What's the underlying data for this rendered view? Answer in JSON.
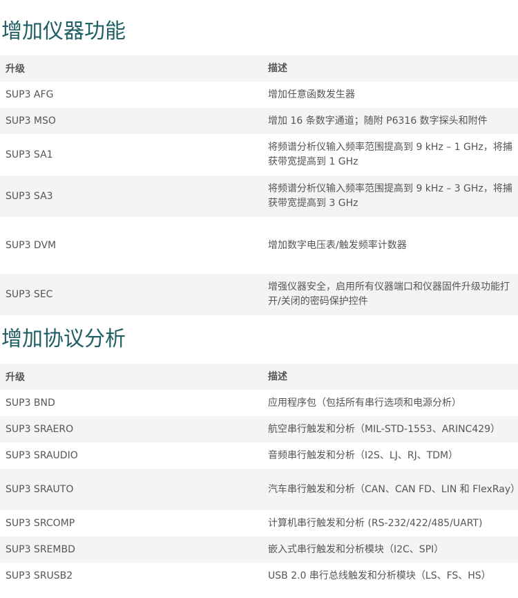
{
  "sections": [
    {
      "title": "增加仪器功能",
      "headers": [
        "升级",
        "描述"
      ],
      "rows": [
        {
          "upgrade": "SUP3 AFG",
          "description": "增加任意函数发生器"
        },
        {
          "upgrade": "SUP3 MSO",
          "description": "增加 16 条数字通道；随附 P6316 数字探头和附件"
        },
        {
          "upgrade": "SUP3 SA1",
          "description": "将频谱分析仪输入频率范围提高到 9 kHz – 1 GHz，将捕获带宽提高到 1 GHz"
        },
        {
          "upgrade": "SUP3 SA3",
          "description": "将频谱分析仪输入频率范围提高到 9 kHz – 3 GHz，将捕获带宽提高到 3 GHz"
        },
        {
          "upgrade": "SUP3 DVM",
          "description": "增加数字电压表/触发频率计数器"
        },
        {
          "upgrade": "SUP3 SEC",
          "description": "增强仪器安全，启用所有仪器端口和仪器固件升级功能打开/关闭的密码保护控件"
        }
      ]
    },
    {
      "title": "增加协议分析",
      "headers": [
        "升级",
        "描述"
      ],
      "rows": [
        {
          "upgrade": "SUP3 BND",
          "description": "应用程序包（包括所有串行选项和电源分析）"
        },
        {
          "upgrade": "SUP3 SRAERO",
          "description": "航空串行触发和分析（MIL-STD-1553、ARINC429）"
        },
        {
          "upgrade": "SUP3 SRAUDIO",
          "description": "音频串行触发和分析（I2S、LJ、RJ、TDM）"
        },
        {
          "upgrade": "SUP3 SRAUTO",
          "description": "汽车串行触发和分析（CAN、CAN FD、LIN 和 FlexRay）"
        },
        {
          "upgrade": "SUP3 SRCOMP",
          "description": "计算机串行触发和分析 (RS-232/422/485/UART)"
        },
        {
          "upgrade": "SUP3 SREMBD",
          "description": "嵌入式串行触发和分析模块（I2C、SPI）"
        },
        {
          "upgrade": "SUP3 SRUSB2",
          "description": "USB 2.0 串行总线触发和分析模块（LS、FS、HS）"
        }
      ]
    }
  ]
}
